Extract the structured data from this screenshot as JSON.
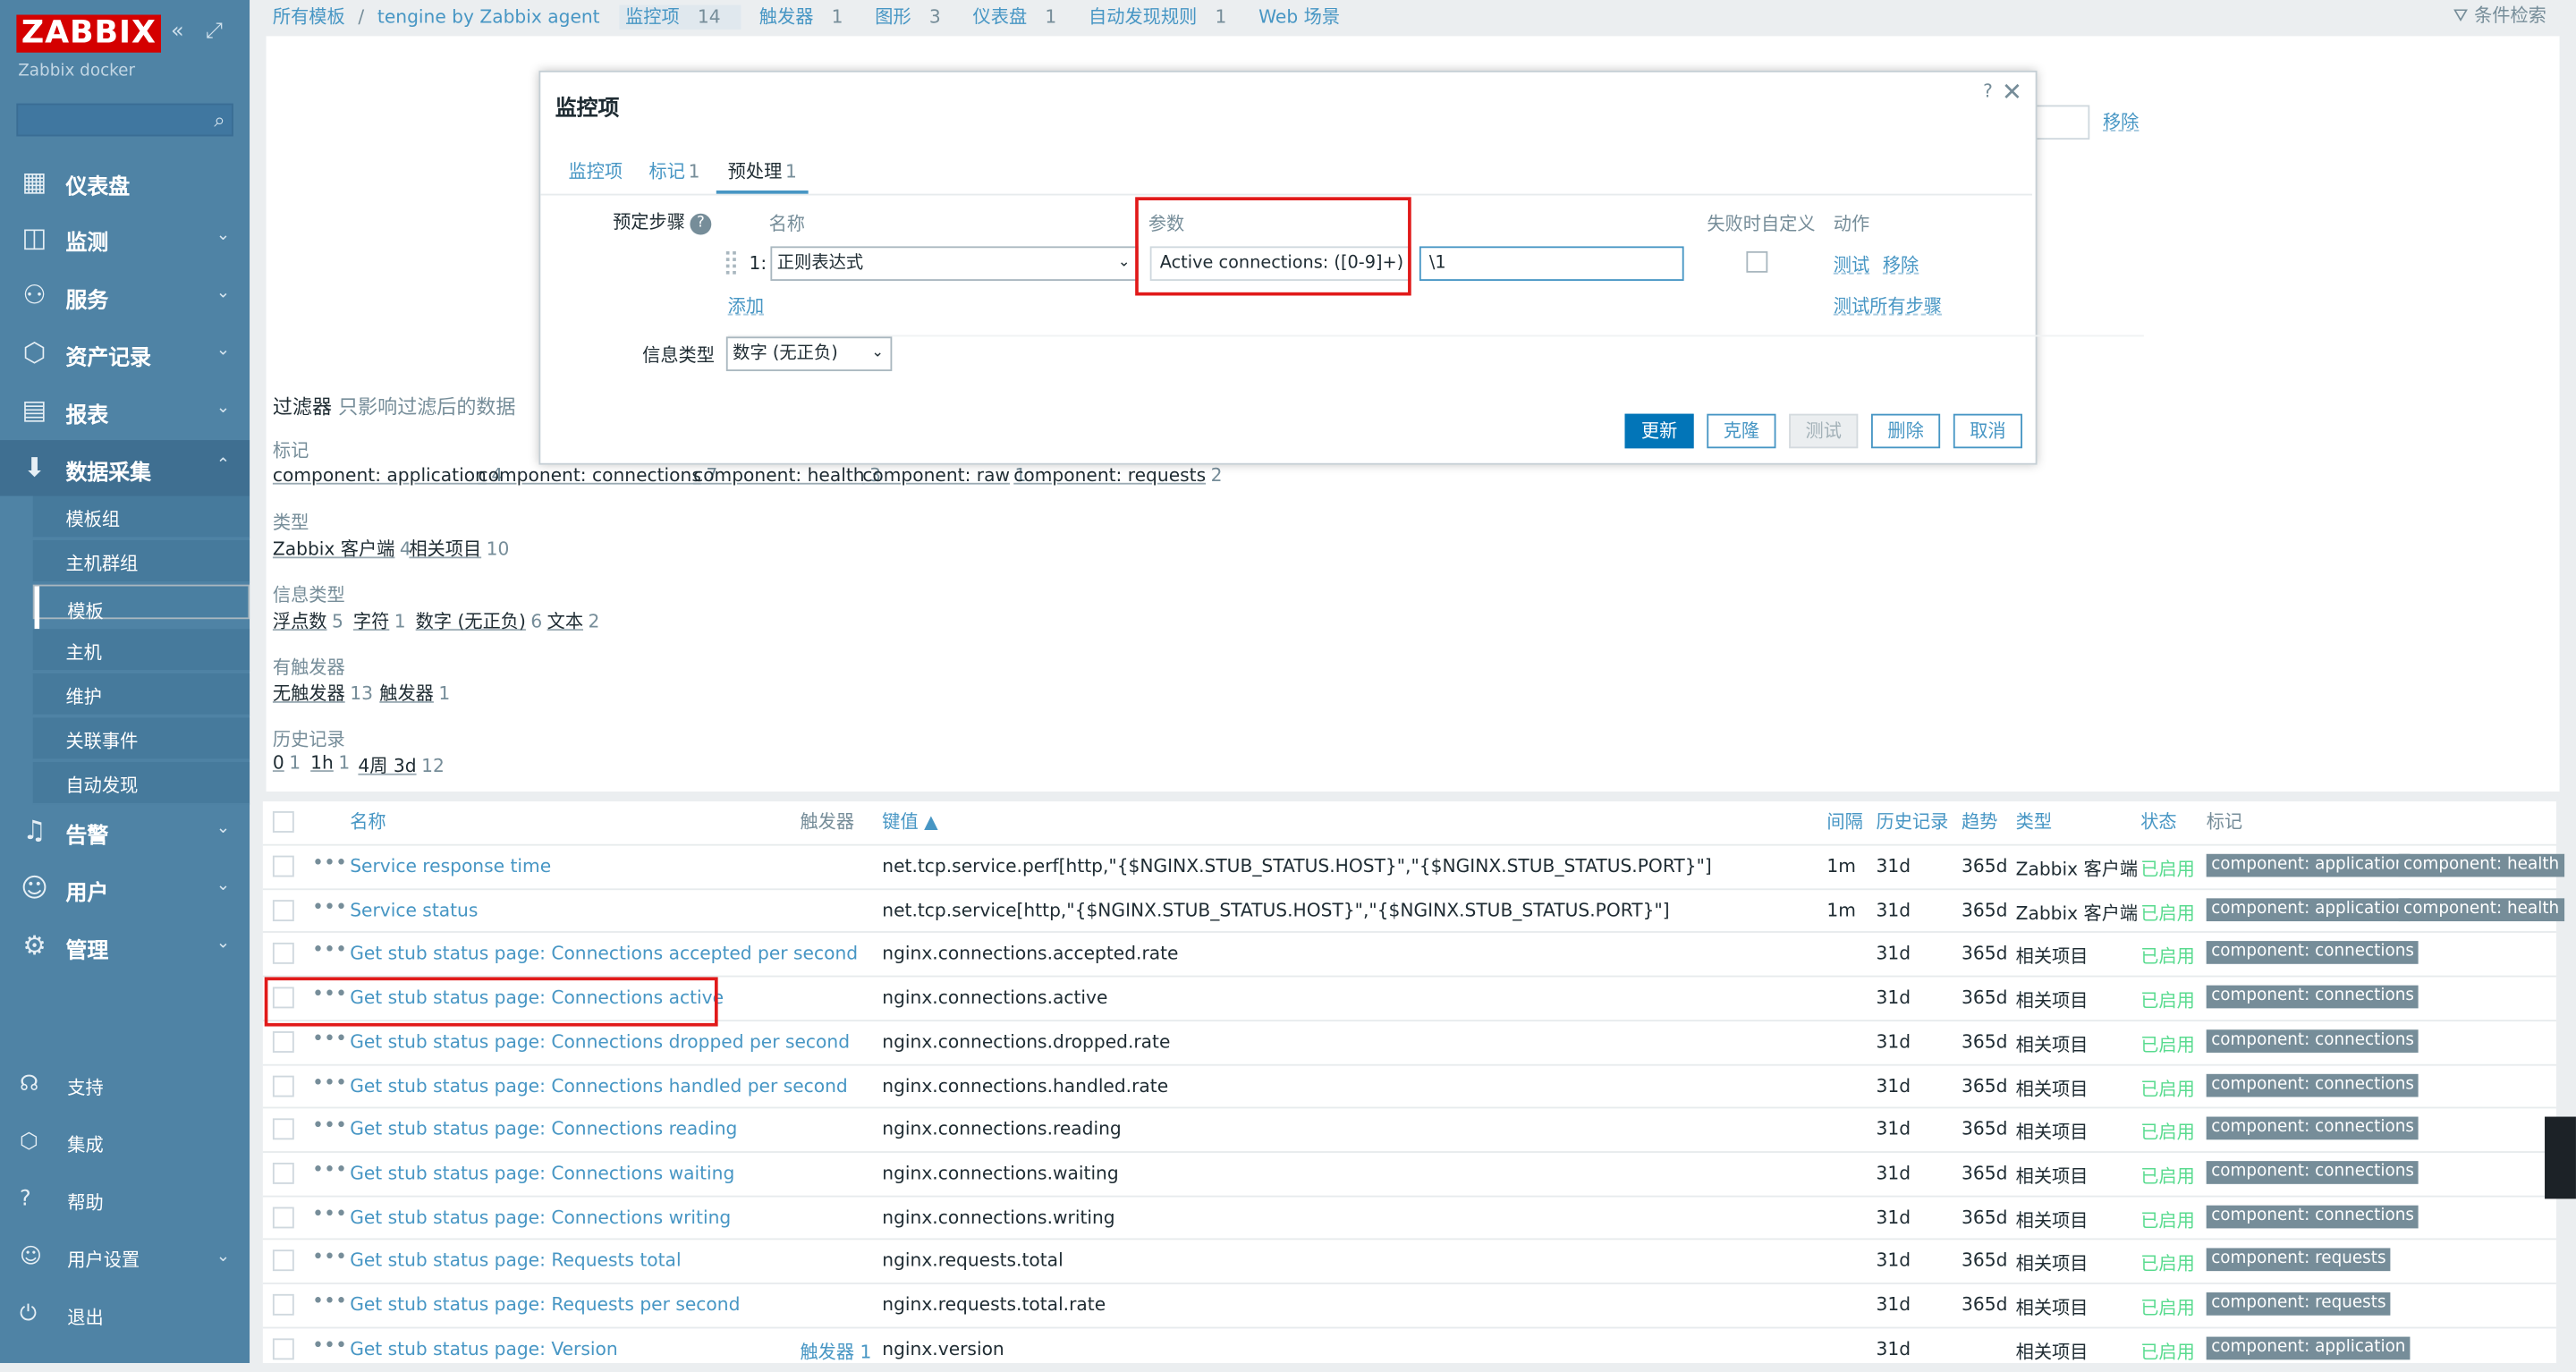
{
  "sidebar": {
    "logo": "ZABBIX",
    "subtitle": "Zabbix docker",
    "search_placeholder": "",
    "collapse_icon": "double-chevron-left-icon",
    "kiosk_icon": "expand-icon",
    "nav": [
      {
        "label": "仪表盘",
        "icon": "dashboard-icon"
      },
      {
        "label": "监测",
        "icon": "monitoring-icon"
      },
      {
        "label": "服务",
        "icon": "services-icon"
      },
      {
        "label": "资产记录",
        "icon": "inventory-icon"
      },
      {
        "label": "报表",
        "icon": "reports-icon"
      },
      {
        "label": "数据采集",
        "icon": "data-collection-icon"
      }
    ],
    "sub": [
      "模板组",
      "主机群组",
      "模板",
      "主机",
      "维护",
      "关联事件",
      "自动发现"
    ],
    "nav_lower": [
      {
        "label": "告警",
        "icon": "bell-icon"
      },
      {
        "label": "用户",
        "icon": "user-icon"
      },
      {
        "label": "管理",
        "icon": "gear-icon"
      }
    ],
    "footer": [
      {
        "label": "支持",
        "icon": "headset-icon"
      },
      {
        "label": "集成",
        "icon": "integrations-icon"
      },
      {
        "label": "帮助",
        "icon": "help-icon"
      },
      {
        "label": "用户设置",
        "icon": "user-settings-icon"
      },
      {
        "label": "退出",
        "icon": "power-icon"
      }
    ]
  },
  "breadcrumb": {
    "all_templates": "所有模板",
    "separator": "/",
    "template": "tengine by Zabbix agent",
    "tabs": [
      {
        "label": "监控项",
        "count": "14"
      },
      {
        "label": "触发器",
        "count": "1"
      },
      {
        "label": "图形",
        "count": "3"
      },
      {
        "label": "仪表盘",
        "count": "1"
      },
      {
        "label": "自动发现规则",
        "count": "1"
      },
      {
        "label": "Web 场景",
        "count": ""
      }
    ],
    "filter_label": "条件检索"
  },
  "filter": {
    "remove_link": "移除",
    "title": "过滤器",
    "subtitle": "只影响过滤后的数据",
    "tags_label": "标记",
    "tags": [
      {
        "name": "component: application",
        "count": "4"
      },
      {
        "name": "component: connections",
        "count": "7"
      },
      {
        "name": "component: health",
        "count": "3"
      },
      {
        "name": "component: raw",
        "count": "1"
      },
      {
        "name": "component: requests",
        "count": "2"
      }
    ],
    "type_label": "类型",
    "types": [
      {
        "name": "Zabbix 客户端",
        "count": "4"
      },
      {
        "name": "相关项目",
        "count": "10"
      }
    ],
    "info_label": "信息类型",
    "infos": [
      {
        "name": "浮点数",
        "count": "5"
      },
      {
        "name": "字符",
        "count": "1"
      },
      {
        "name": "数字 (无正负)",
        "count": "6"
      },
      {
        "name": "文本",
        "count": "2"
      }
    ],
    "trig_label": "有触发器",
    "trigs": [
      {
        "name": "无触发器",
        "count": "13"
      },
      {
        "name": "触发器",
        "count": "1"
      }
    ],
    "hist_label": "历史记录",
    "hists": [
      {
        "name": "0",
        "count": "1"
      },
      {
        "name": "1h",
        "count": "1"
      },
      {
        "name": "4周 3d",
        "count": "12"
      }
    ]
  },
  "table": {
    "headers": {
      "name": "名称",
      "triggers": "触发器",
      "key": "键值 ▲",
      "interval": "间隔",
      "history": "历史记录",
      "trends": "趋势",
      "type": "类型",
      "status": "状态",
      "tags": "标记"
    },
    "rows": [
      {
        "name": "Service response time",
        "triggers": "",
        "key": "net.tcp.service.perf[http,\"{$NGINX.STUB_STATUS.HOST}\",\"{$NGINX.STUB_STATUS.PORT}\"]",
        "interval": "1m",
        "history": "31d",
        "trends": "365d",
        "type": "Zabbix 客户端",
        "status": "已启用",
        "tags": [
          "component: application",
          "component: health"
        ]
      },
      {
        "name": "Service status",
        "triggers": "",
        "key": "net.tcp.service[http,\"{$NGINX.STUB_STATUS.HOST}\",\"{$NGINX.STUB_STATUS.PORT}\"]",
        "interval": "1m",
        "history": "31d",
        "trends": "365d",
        "type": "Zabbix 客户端",
        "status": "已启用",
        "tags": [
          "component: application",
          "component: health"
        ]
      },
      {
        "name": "Get stub status page: Connections accepted per second",
        "triggers": "",
        "key": "nginx.connections.accepted.rate",
        "interval": "",
        "history": "31d",
        "trends": "365d",
        "type": "相关项目",
        "status": "已启用",
        "tags": [
          "component: connections"
        ]
      },
      {
        "name": "Get stub status page: Connections active",
        "triggers": "",
        "key": "nginx.connections.active",
        "interval": "",
        "history": "31d",
        "trends": "365d",
        "type": "相关项目",
        "status": "已启用",
        "tags": [
          "component: connections"
        ]
      },
      {
        "name": "Get stub status page: Connections dropped per second",
        "triggers": "",
        "key": "nginx.connections.dropped.rate",
        "interval": "",
        "history": "31d",
        "trends": "365d",
        "type": "相关项目",
        "status": "已启用",
        "tags": [
          "component: connections"
        ]
      },
      {
        "name": "Get stub status page: Connections handled per second",
        "triggers": "",
        "key": "nginx.connections.handled.rate",
        "interval": "",
        "history": "31d",
        "trends": "365d",
        "type": "相关项目",
        "status": "已启用",
        "tags": [
          "component: connections"
        ]
      },
      {
        "name": "Get stub status page: Connections reading",
        "triggers": "",
        "key": "nginx.connections.reading",
        "interval": "",
        "history": "31d",
        "trends": "365d",
        "type": "相关项目",
        "status": "已启用",
        "tags": [
          "component: connections"
        ]
      },
      {
        "name": "Get stub status page: Connections waiting",
        "triggers": "",
        "key": "nginx.connections.waiting",
        "interval": "",
        "history": "31d",
        "trends": "365d",
        "type": "相关项目",
        "status": "已启用",
        "tags": [
          "component: connections"
        ]
      },
      {
        "name": "Get stub status page: Connections writing",
        "triggers": "",
        "key": "nginx.connections.writing",
        "interval": "",
        "history": "31d",
        "trends": "365d",
        "type": "相关项目",
        "status": "已启用",
        "tags": [
          "component: connections"
        ]
      },
      {
        "name": "Get stub status page: Requests total",
        "triggers": "",
        "key": "nginx.requests.total",
        "interval": "",
        "history": "31d",
        "trends": "365d",
        "type": "相关项目",
        "status": "已启用",
        "tags": [
          "component: requests"
        ]
      },
      {
        "name": "Get stub status page: Requests per second",
        "triggers": "",
        "key": "nginx.requests.total.rate",
        "interval": "",
        "history": "31d",
        "trends": "365d",
        "type": "相关项目",
        "status": "已启用",
        "tags": [
          "component: requests"
        ]
      },
      {
        "name": "Get stub status page: Version",
        "triggers": "触发器 1",
        "key": "nginx.version",
        "interval": "",
        "history": "31d",
        "trends": "",
        "type": "相关项目",
        "status": "已启用",
        "tags": [
          "component: application"
        ]
      }
    ]
  },
  "dialog": {
    "title": "监控项",
    "help": "?",
    "close": "✕",
    "tabs": [
      {
        "label": "监控项",
        "count": ""
      },
      {
        "label": "标记",
        "count": "1"
      },
      {
        "label": "预处理",
        "count": "1"
      }
    ],
    "steps_label": "预定步骤",
    "col_name": "名称",
    "col_params": "参数",
    "col_custom": "失败时自定义",
    "col_action": "动作",
    "step_num": "1:",
    "step_type": "正则表达式",
    "param1": "Active connections: ([0-9]+)",
    "param2": "\\1",
    "test_link": "测试",
    "remove_link": "移除",
    "add_link": "添加",
    "test_all_link": "测试所有步骤",
    "info_type_label": "信息类型",
    "info_type_value": "数字 (无正负)",
    "buttons": {
      "update": "更新",
      "clone": "克隆",
      "test": "测试",
      "delete": "删除",
      "cancel": "取消"
    }
  },
  "colors": {
    "sidebar": "#4f83a5",
    "link": "#4796c4",
    "status_enabled": "#59db8f",
    "primary_button": "#0275b8",
    "highlight": "#e11a1a"
  }
}
